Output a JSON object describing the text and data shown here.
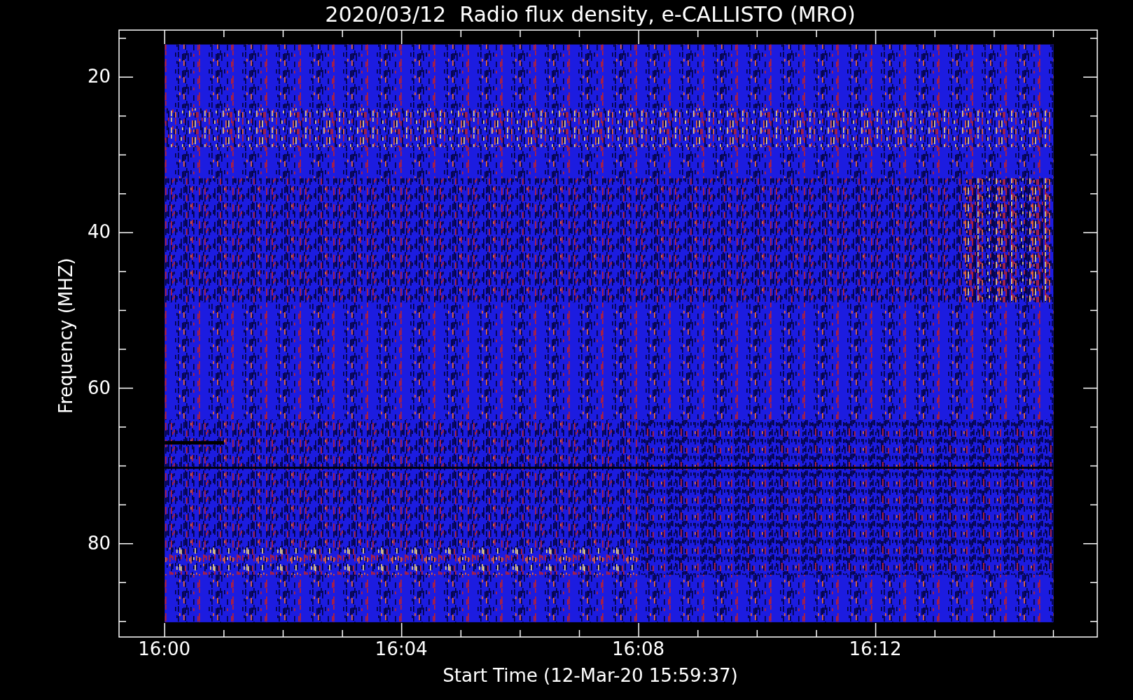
{
  "title": "2020/03/12  Radio flux density, e-CALLISTO (MRO)",
  "plot": {
    "ylabel": "Frequency (MHZ)",
    "xlabel": "Start Time (12-Mar-20 15:59:37)",
    "xticks": [
      "16:00",
      "16:04",
      "16:08",
      "16:12"
    ],
    "yticks": [
      "20",
      "40",
      "60",
      "80"
    ]
  }
}
